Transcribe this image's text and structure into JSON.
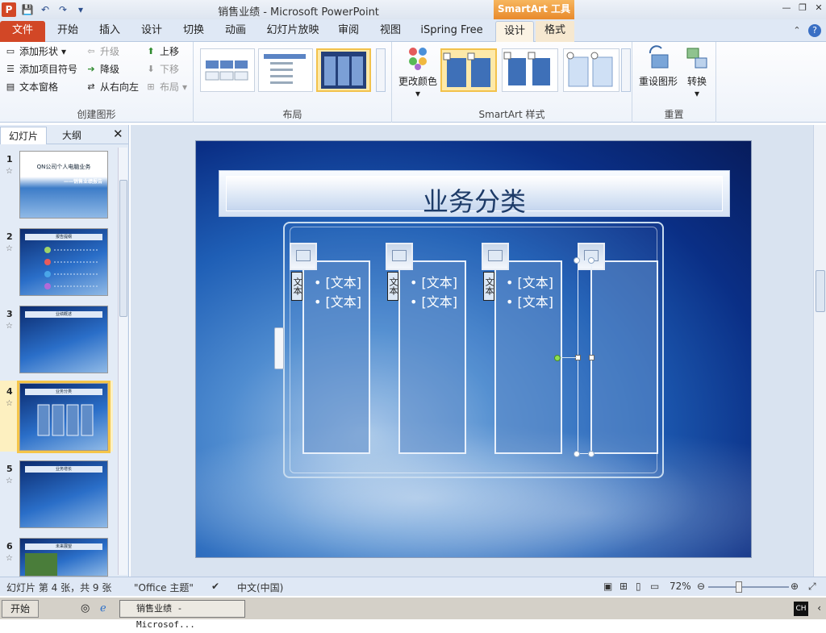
{
  "window": {
    "title": "销售业绩  -  Microsoft PowerPoint",
    "contextual_tab_group": "SmartArt 工具",
    "minimize": "—",
    "restore": "❐",
    "close": "✕"
  },
  "qat": {
    "app_icon": "P",
    "save": "💾",
    "undo": "↶",
    "redo": "↷",
    "customize": "▾"
  },
  "tabs": [
    "文件",
    "开始",
    "插入",
    "设计",
    "切换",
    "动画",
    "幻灯片放映",
    "审阅",
    "视图",
    "iSpring Free",
    "设计",
    "格式"
  ],
  "ribbon": {
    "create_graphic": {
      "label": "创建图形",
      "add_shape": "添加形状",
      "add_bullet": "添加项目符号",
      "text_pane": "文本窗格",
      "promote": "升级",
      "demote": "降级",
      "rtl": "从右向左",
      "move_up": "上移",
      "move_down": "下移",
      "layout": "布局"
    },
    "layouts": {
      "label": "布局"
    },
    "styles": {
      "label": "SmartArt 样式",
      "change_colors": "更改颜色"
    },
    "reset": {
      "label": "重置",
      "reset_graphic": "重设图形",
      "convert": "转换"
    }
  },
  "left_pane": {
    "tab_slides": "幻灯片",
    "tab_outline": "大纲",
    "close": "✕",
    "slides": [
      {
        "num": "1",
        "title": "QN公司个人电脑业务",
        "subtitle": "——销售业绩报告"
      },
      {
        "num": "2",
        "title": "报告提纲"
      },
      {
        "num": "3",
        "title": "业绩概述"
      },
      {
        "num": "4",
        "title": "业务分类"
      },
      {
        "num": "5",
        "title": "业务增长"
      },
      {
        "num": "6",
        "title": "未来展望"
      }
    ]
  },
  "slide": {
    "title": "业务分类",
    "placeholder_bullet": "[文本]",
    "vertical_label": "文本",
    "columns": [
      {
        "bullets": [
          "[文本]",
          "[文本]"
        ]
      },
      {
        "bullets": [
          "[文本]",
          "[文本]"
        ]
      },
      {
        "bullets": [
          "[文本]",
          "[文本]"
        ]
      },
      {
        "bullets": []
      }
    ]
  },
  "status": {
    "slide_info": "幻灯片 第 4 张，共 9 张",
    "theme": "\"Office 主题\"",
    "language": "中文(中国)",
    "zoom": "72%",
    "zoom_level": 0.72
  },
  "taskbar": {
    "start": "开始",
    "item": "销售业绩 - Microsof...",
    "ime": "CH"
  }
}
